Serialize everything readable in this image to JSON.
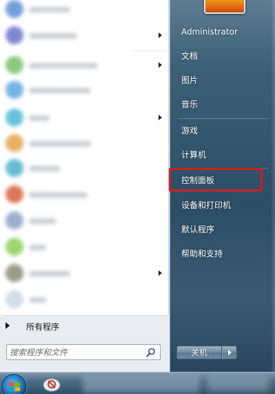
{
  "start_menu": {
    "user_name": "Administrator",
    "right_items": [
      {
        "label": "文档",
        "has_submenu": false
      },
      {
        "label": "图片",
        "has_submenu": false
      },
      {
        "label": "音乐",
        "has_submenu": false
      },
      {
        "label": "游戏",
        "has_submenu": false
      },
      {
        "label": "计算机",
        "has_submenu": false
      },
      {
        "label": "控制面板",
        "has_submenu": false,
        "highlighted": true
      },
      {
        "label": "设备和打印机",
        "has_submenu": false
      },
      {
        "label": "默认程序",
        "has_submenu": false
      },
      {
        "label": "帮助和支持",
        "has_submenu": false
      }
    ],
    "all_programs_label": "所有程序",
    "search": {
      "placeholder": "搜索程序和文件"
    },
    "shutdown_label": "关机"
  },
  "colors": {
    "highlight_border": "#d11f1f",
    "left_panel_bg": "#ffffff",
    "right_panel_bg": "#2c4d66"
  },
  "icons": {
    "search": "search-icon",
    "start_orb": "windows-orb-icon",
    "taskbar_app": "network-app-icon"
  }
}
